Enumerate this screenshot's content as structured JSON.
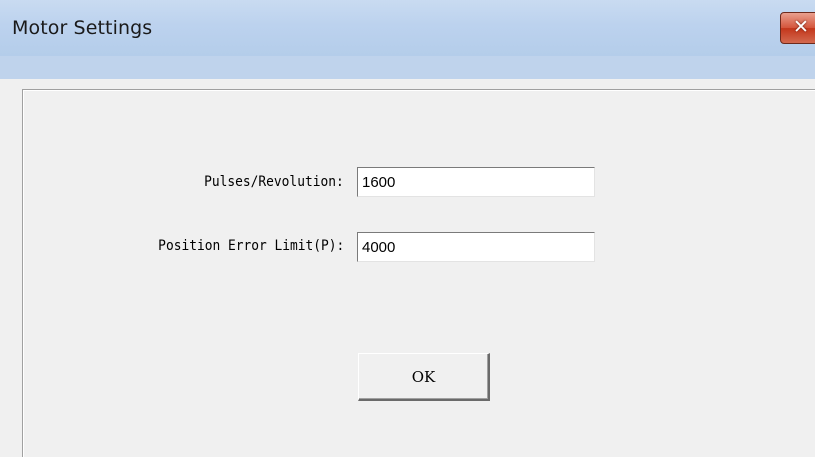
{
  "window": {
    "title": "Motor Settings",
    "close_icon": "close-icon",
    "close_glyph": "✕"
  },
  "form": {
    "pulses_label": "Pulses/Revolution:",
    "pulses_value": "1600",
    "error_label": "Position Error Limit(P):",
    "error_value": "4000",
    "ok_label": "OK"
  },
  "colors": {
    "titlebar": "#bcd2ee",
    "close_button": "#c3361b",
    "dialog_background": "#f0f0f0"
  }
}
